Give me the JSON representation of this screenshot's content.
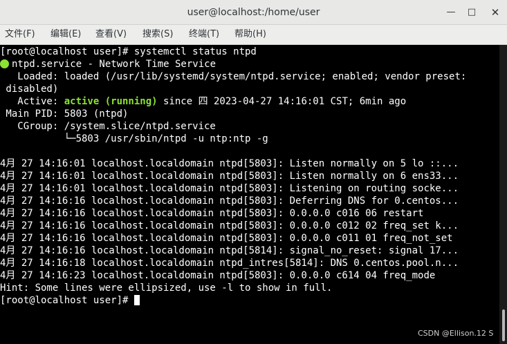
{
  "window": {
    "title": "user@localhost:/home/user",
    "minimize_glyph": "—",
    "maximize_glyph": "□",
    "close_glyph": "✕"
  },
  "menu": [
    "文件(F)",
    "编辑(E)",
    "查看(V)",
    "搜索(S)",
    "终端(T)",
    "帮助(H)"
  ],
  "terminal": {
    "lines": [
      "[root@localhost user]# systemctl status ntpd",
      "ntpd.service - Network Time Service",
      "   Loaded: loaded (/usr/lib/systemd/system/ntpd.service; enabled; vendor preset:",
      " disabled)",
      "   Active: ",
      "active (running)",
      " since 四 2023-04-27 14:16:01 CST; 6min ago",
      " Main PID: 5803 (ntpd)",
      "   CGroup: /system.slice/ntpd.service",
      "           └─5803 /usr/sbin/ntpd -u ntp:ntp -g",
      "",
      "4月 27 14:16:01 localhost.localdomain ntpd[5803]: Listen normally on 5 lo ::...",
      "4月 27 14:16:01 localhost.localdomain ntpd[5803]: Listen normally on 6 ens33...",
      "4月 27 14:16:01 localhost.localdomain ntpd[5803]: Listening on routing socke...",
      "4月 27 14:16:16 localhost.localdomain ntpd[5803]: Deferring DNS for 0.centos...",
      "4月 27 14:16:16 localhost.localdomain ntpd[5803]: 0.0.0.0 c016 06 restart",
      "4月 27 14:16:16 localhost.localdomain ntpd[5803]: 0.0.0.0 c012 02 freq_set k...",
      "4月 27 14:16:16 localhost.localdomain ntpd[5803]: 0.0.0.0 c011 01 freq_not_set",
      "4月 27 14:16:16 localhost.localdomain ntpd[5814]: signal_no_reset: signal 17...",
      "4月 27 14:16:18 localhost.localdomain ntpd_intres[5814]: DNS 0.centos.pool.n...",
      "4月 27 14:16:23 localhost.localdomain ntpd[5803]: 0.0.0.0 c614 04 freq_mode",
      "Hint: Some lines were ellipsized, use -l to show in full.",
      "[root@localhost user]# "
    ]
  },
  "watermark": "CSDN @Ellison.12 S",
  "colors": {
    "green": "#8ae234",
    "background": "#000000",
    "text": "#ffffff",
    "titlebar": "#e8e8e7"
  }
}
